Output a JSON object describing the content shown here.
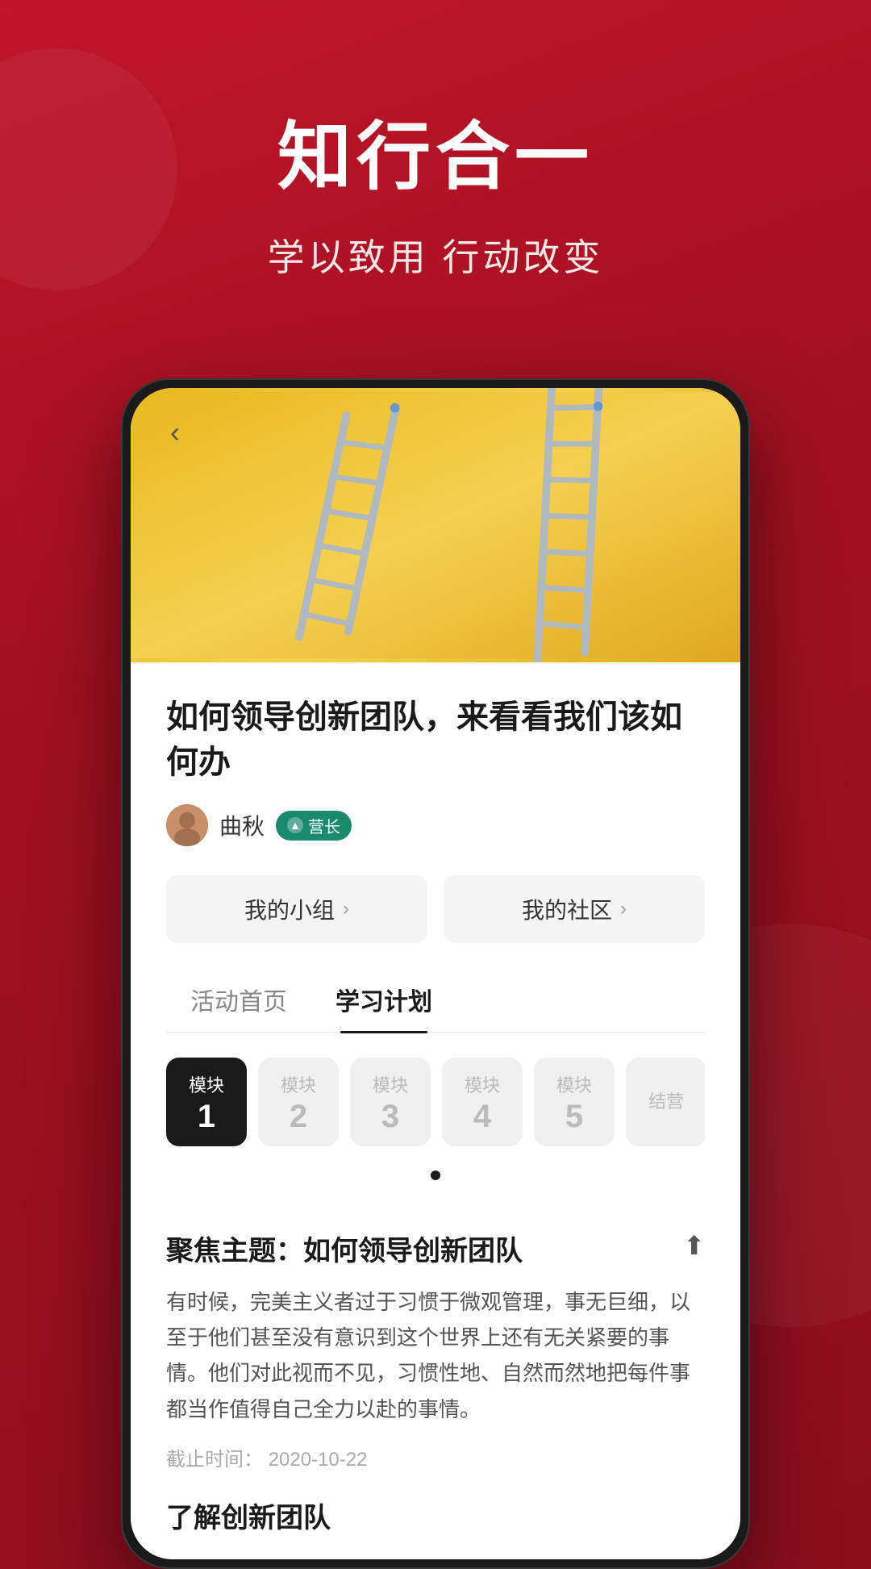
{
  "hero": {
    "title": "知行合一",
    "subtitle": "学以致用 行动改变"
  },
  "phone": {
    "back_button": "‹",
    "article_title": "如何领导创新团队，来看看我们该如何办",
    "author": {
      "name": "曲秋",
      "badge": "营长",
      "badge_icon": "▲"
    },
    "nav_buttons": [
      {
        "label": "我的小组",
        "arrow": "›"
      },
      {
        "label": "我的社区",
        "arrow": "›"
      }
    ],
    "tabs": [
      {
        "label": "活动首页",
        "active": false
      },
      {
        "label": "学习计划",
        "active": true
      }
    ],
    "modules": [
      {
        "label": "模块",
        "num": "1",
        "active": true
      },
      {
        "label": "模块",
        "num": "2",
        "active": false
      },
      {
        "label": "模块",
        "num": "3",
        "active": false
      },
      {
        "label": "模块",
        "num": "4",
        "active": false
      },
      {
        "label": "模块",
        "num": "5",
        "active": false
      },
      {
        "label": "结营",
        "num": "",
        "active": false
      }
    ],
    "focus": {
      "title": "聚焦主题：如何领导创新团队",
      "body": "有时候，完美主义者过于习惯于微观管理，事无巨细，以至于他们甚至没有意识到这个世界上还有无关紧要的事情。他们对此视而不见，习惯性地、自然而然地把每件事都当作值得自己全力以赴的事情。",
      "deadline_label": "截止时间：",
      "deadline_value": "2020-10-22",
      "section_title": "了解创新团队"
    }
  }
}
